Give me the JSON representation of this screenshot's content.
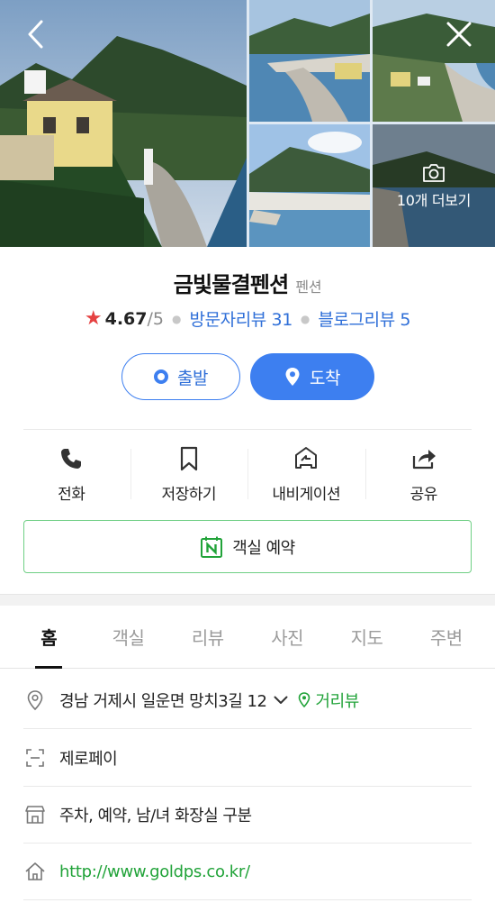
{
  "gallery": {
    "more_label": "10개 더보기"
  },
  "place": {
    "name": "금빛물결펜션",
    "category": "펜션",
    "rating": "4.67",
    "rating_max": "/5",
    "visitor_reviews": "방문자리뷰 31",
    "blog_reviews": "블로그리뷰 5"
  },
  "directions": {
    "start_label": "출발",
    "end_label": "도착"
  },
  "actions": [
    {
      "label": "전화",
      "icon": "phone-icon"
    },
    {
      "label": "저장하기",
      "icon": "bookmark-icon"
    },
    {
      "label": "내비게이션",
      "icon": "navigation-car-icon"
    },
    {
      "label": "공유",
      "icon": "share-icon"
    }
  ],
  "reserve": {
    "label": "객실 예약",
    "icon": "naver-booking-icon"
  },
  "tabs": [
    {
      "label": "홈",
      "active": true
    },
    {
      "label": "객실",
      "active": false
    },
    {
      "label": "리뷰",
      "active": false
    },
    {
      "label": "사진",
      "active": false
    },
    {
      "label": "지도",
      "active": false
    },
    {
      "label": "주변",
      "active": false
    }
  ],
  "info": {
    "address": "경남 거제시 일운면 망치3길 12",
    "distance_label": "거리뷰",
    "zeropay": "제로페이",
    "facilities": "주차, 예약, 남/녀 화장실 구분",
    "website": "http://www.goldps.co.kr/"
  },
  "colors": {
    "accent_blue": "#3d7ff0",
    "link_blue": "#2f6fd8",
    "naver_green": "#21a339",
    "star_red": "#e54141"
  }
}
